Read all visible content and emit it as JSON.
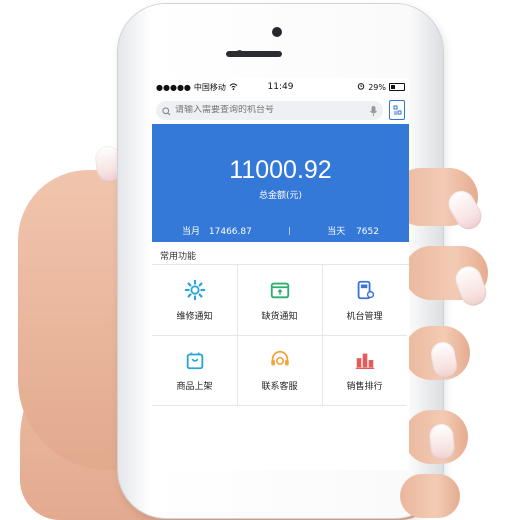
{
  "status_bar": {
    "carrier": "中国移动",
    "time": "11:49",
    "battery": "29%"
  },
  "search": {
    "placeholder": "请输入需要查询的机台号"
  },
  "summary": {
    "amount": "11000.92",
    "amount_label": "总金额(元)",
    "month_label": "当月",
    "month_value": "17466.87",
    "today_label": "当天",
    "today_value": "7652"
  },
  "section": {
    "title": "常用功能"
  },
  "functions": [
    {
      "label": "维修通知",
      "icon": "gear-icon",
      "color": "#2aa5d8"
    },
    {
      "label": "缺货通知",
      "icon": "box-icon",
      "color": "#2fae6a"
    },
    {
      "label": "机台管理",
      "icon": "machine-icon",
      "color": "#3a74d6"
    },
    {
      "label": "商品上架",
      "icon": "shopping-bag-icon",
      "color": "#2aa5d8"
    },
    {
      "label": "联系客服",
      "icon": "headset-icon",
      "color": "#f2a53a"
    },
    {
      "label": "销售排行",
      "icon": "ranking-icon",
      "color": "#e65a5a"
    }
  ],
  "colors": {
    "primary": "#3478d8"
  }
}
